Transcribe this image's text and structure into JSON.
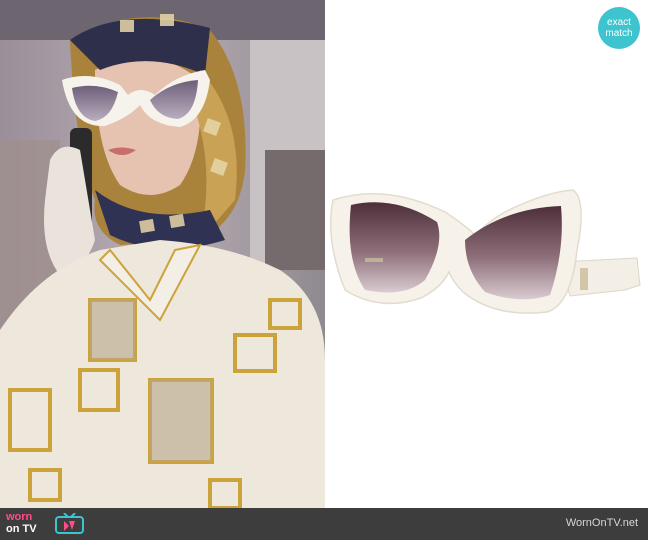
{
  "badge": {
    "line1": "exact",
    "line2": "match"
  },
  "footer": {
    "logo_line1": "worn",
    "logo_line2": "on TV",
    "site": "WornOnTV.net"
  },
  "colors": {
    "accent": "#3ec4cf",
    "logo_pink": "#ff4b8a",
    "footer_bg": "#3d3d3d",
    "frame_white": "#f3efe6"
  }
}
